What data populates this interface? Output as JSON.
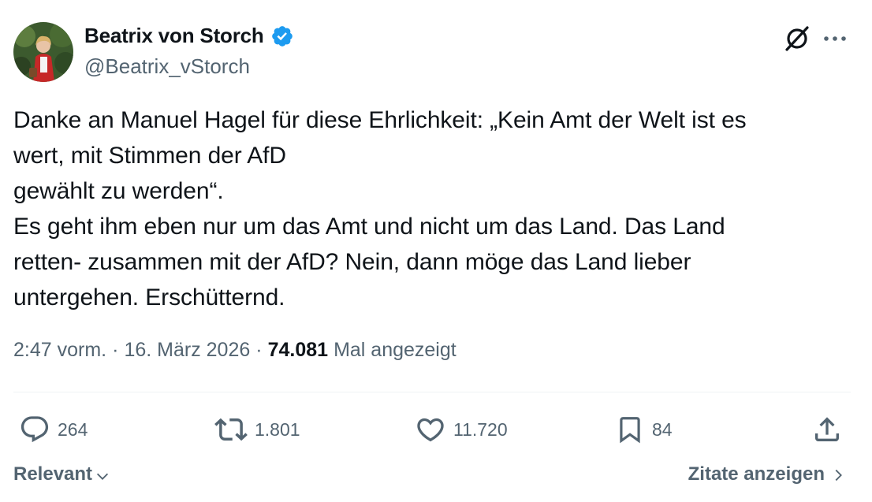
{
  "author": {
    "display_name": "Beatrix von Storch",
    "handle": "@Beatrix_vStorch",
    "verified": true
  },
  "tweet": {
    "lines": [
      "Danke an Manuel Hagel für diese Ehrlichkeit: „Kein Amt der Welt ist es",
      "wert, mit Stimmen der AfD",
      "gewählt zu werden“.",
      "Es geht ihm eben nur um das Amt und nicht um das Land. Das Land",
      "retten- zusammen mit der AfD? Nein, dann möge das Land lieber",
      "untergehen. Erschütternd."
    ],
    "time": "2:47 vorm.",
    "date": "16. März 2026",
    "separator": "·",
    "views_count": "74.081",
    "views_label": "Mal angezeigt"
  },
  "actions": {
    "replies": "264",
    "reposts": "1.801",
    "likes": "11.720",
    "bookmarks": "84"
  },
  "footer": {
    "sort_label": "Relevant",
    "quotes_label": "Zitate anzeigen"
  },
  "colors": {
    "text": "#0f1419",
    "secondary": "#536471",
    "verified_blue": "#1d9bf0",
    "divider": "#eff3f4"
  },
  "icons": {
    "grok": "grok-icon",
    "more": "more-icon",
    "reply": "reply-icon",
    "repost": "repost-icon",
    "like": "heart-icon",
    "bookmark": "bookmark-icon",
    "share": "share-icon",
    "verified": "verified-badge-icon"
  }
}
